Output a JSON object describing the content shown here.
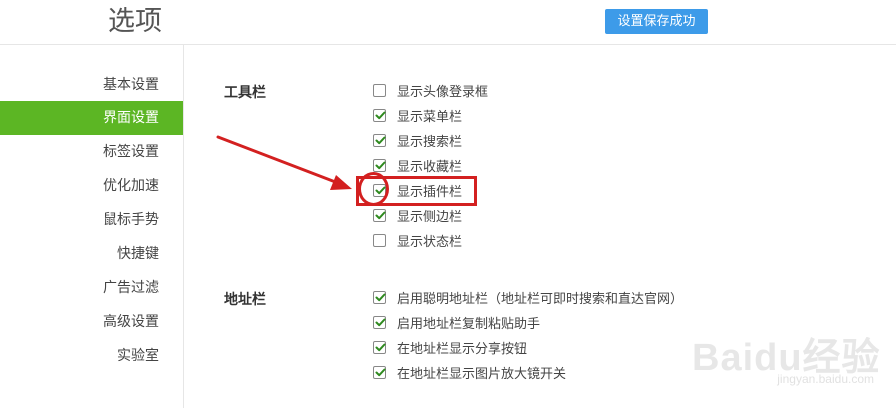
{
  "header": {
    "title": "选项",
    "save_button": "设置保存成功"
  },
  "sidebar": {
    "items": [
      {
        "label": "基本设置",
        "active": false
      },
      {
        "label": "界面设置",
        "active": true
      },
      {
        "label": "标签设置",
        "active": false
      },
      {
        "label": "优化加速",
        "active": false
      },
      {
        "label": "鼠标手势",
        "active": false
      },
      {
        "label": "快捷键",
        "active": false
      },
      {
        "label": "广告过滤",
        "active": false
      },
      {
        "label": "高级设置",
        "active": false
      },
      {
        "label": "实验室",
        "active": false
      }
    ]
  },
  "toolbar_section": {
    "label": "工具栏",
    "options": [
      {
        "label": "显示头像登录框",
        "checked": false
      },
      {
        "label": "显示菜单栏",
        "checked": true
      },
      {
        "label": "显示搜索栏",
        "checked": true
      },
      {
        "label": "显示收藏栏",
        "checked": true
      },
      {
        "label": "显示插件栏",
        "checked": true
      },
      {
        "label": "显示侧边栏",
        "checked": true
      },
      {
        "label": "显示状态栏",
        "checked": false
      }
    ]
  },
  "address_section": {
    "label": "地址栏",
    "options": [
      {
        "label": "启用聪明地址栏（地址栏可即时搜索和直达官网）",
        "checked": true
      },
      {
        "label": "启用地址栏复制粘贴助手",
        "checked": true
      },
      {
        "label": "在地址栏显示分享按钮",
        "checked": true
      },
      {
        "label": "在地址栏显示图片放大镜开关",
        "checked": true
      }
    ]
  },
  "colors": {
    "accent_green": "#5cb624",
    "button_blue": "#3d9be9",
    "annotation_red": "#d32020"
  },
  "watermark": {
    "brand": "Baidu经验",
    "url": "jingyan.baidu.com"
  }
}
